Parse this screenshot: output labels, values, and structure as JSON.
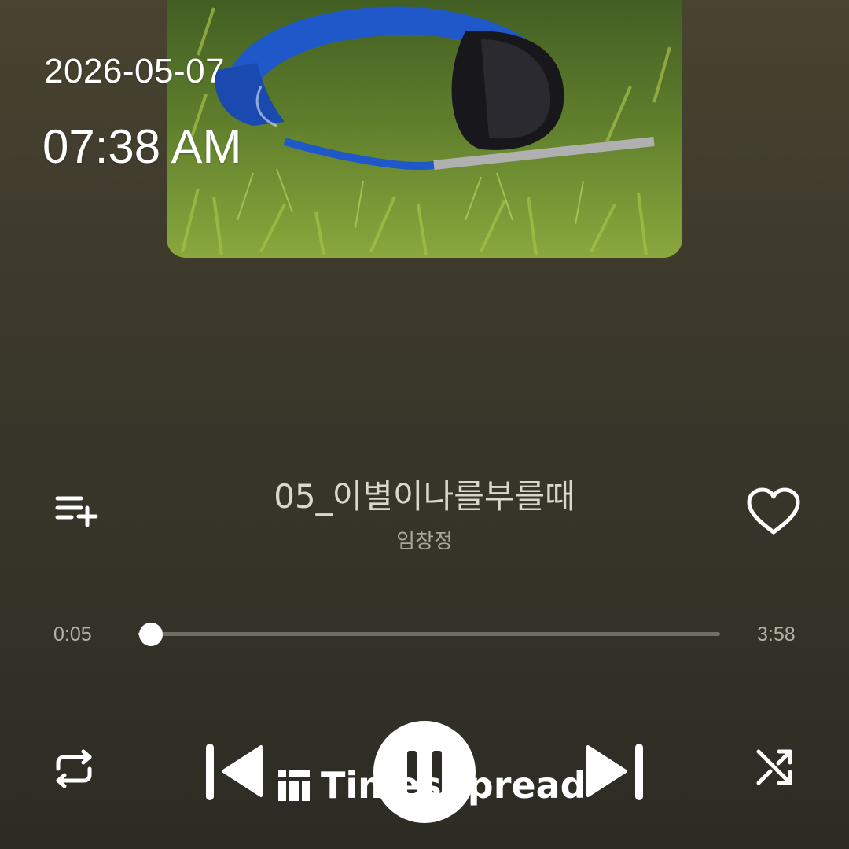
{
  "status": {
    "date": "2026-05-07",
    "time": "07:38 AM"
  },
  "track": {
    "title": "05_이별이나를부를때",
    "artist": "임창정"
  },
  "progress": {
    "elapsed": "0:05",
    "duration": "3:58",
    "fraction": 0.021
  },
  "icons": {
    "add_to_playlist": "playlist-add-icon",
    "favorite": "heart-outline-icon",
    "repeat": "repeat-icon",
    "previous": "skip-previous-icon",
    "play_pause": "pause-icon",
    "next": "skip-next-icon",
    "shuffle": "shuffle-icon"
  },
  "watermark": {
    "text": "TimesSpread"
  },
  "colors": {
    "accent": "#ffffff",
    "track_bg": "#6f6e66",
    "text_muted": "#a9a79c"
  }
}
